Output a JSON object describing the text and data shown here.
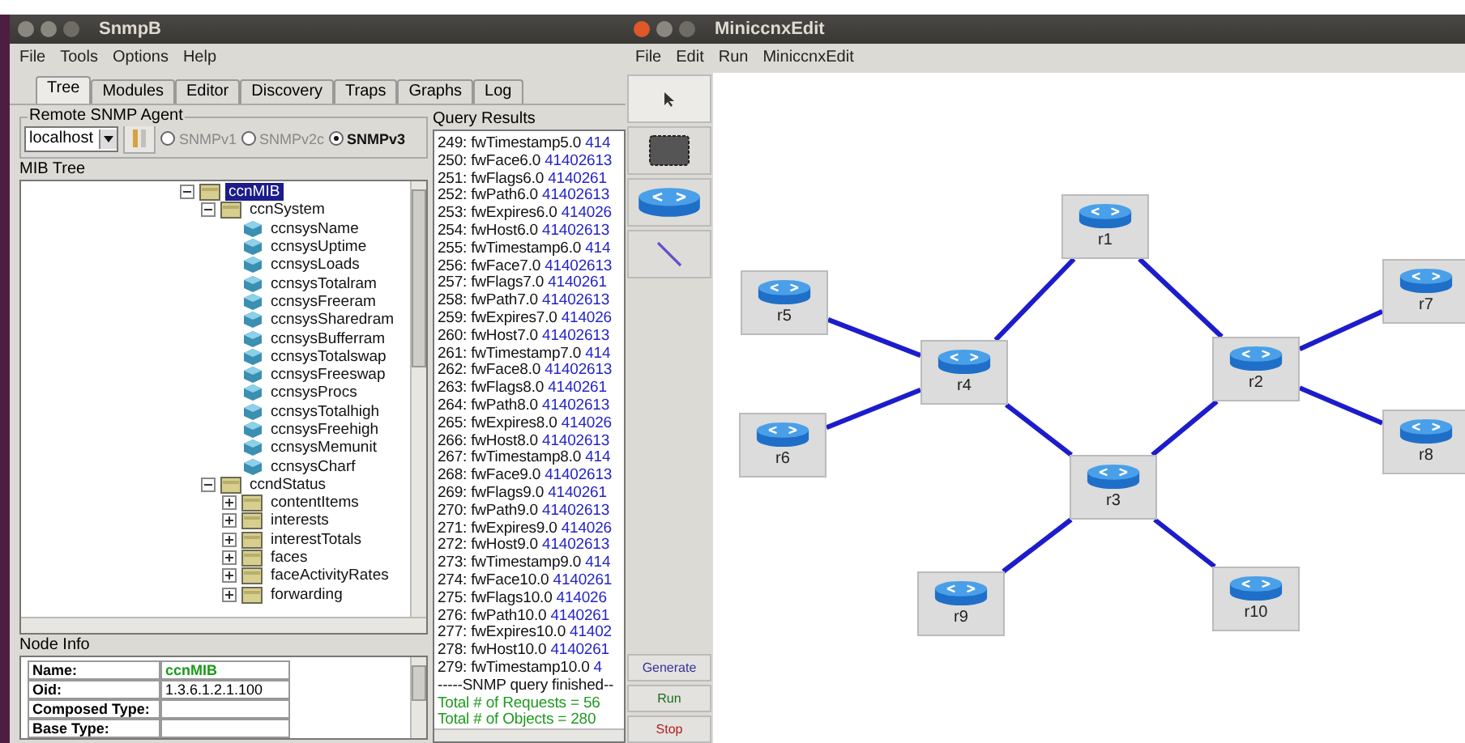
{
  "snmpb": {
    "title": "SnmpB",
    "menu": [
      "File",
      "Tools",
      "Options",
      "Help"
    ],
    "tabs": [
      {
        "label": "Tree",
        "selected": true
      },
      {
        "label": "Modules",
        "selected": false
      },
      {
        "label": "Editor",
        "selected": false
      },
      {
        "label": "Discovery",
        "selected": false
      },
      {
        "label": "Traps",
        "selected": false
      },
      {
        "label": "Graphs",
        "selected": false
      },
      {
        "label": "Log",
        "selected": false
      }
    ],
    "agent": {
      "title": "Remote SNMP Agent",
      "host": "localhost",
      "versions": [
        {
          "label": "SNMPv1",
          "selected": false,
          "disabled": true
        },
        {
          "label": "SNMPv2c",
          "selected": false,
          "disabled": true
        },
        {
          "label": "SNMPv3",
          "selected": true,
          "disabled": false
        }
      ]
    },
    "mib_tree": {
      "title": "MIB Tree",
      "items": [
        {
          "label": "ccnMIB",
          "kind": "folder",
          "expanded": true,
          "selected": true,
          "children": [
            {
              "label": "ccnSystem",
              "kind": "folder",
              "expanded": true,
              "selected": false,
              "children": [
                {
                  "label": "ccnsysName",
                  "kind": "leaf",
                  "selected": false
                },
                {
                  "label": "ccnsysUptime",
                  "kind": "leaf",
                  "selected": false
                },
                {
                  "label": "ccnsysLoads",
                  "kind": "leaf",
                  "selected": false
                },
                {
                  "label": "ccnsysTotalram",
                  "kind": "leaf",
                  "selected": false
                },
                {
                  "label": "ccnsysFreeram",
                  "kind": "leaf",
                  "selected": false
                },
                {
                  "label": "ccnsysSharedram",
                  "kind": "leaf",
                  "selected": false
                },
                {
                  "label": "ccnsysBufferram",
                  "kind": "leaf",
                  "selected": false
                },
                {
                  "label": "ccnsysTotalswap",
                  "kind": "leaf",
                  "selected": false
                },
                {
                  "label": "ccnsysFreeswap",
                  "kind": "leaf",
                  "selected": false
                },
                {
                  "label": "ccnsysProcs",
                  "kind": "leaf",
                  "selected": false
                },
                {
                  "label": "ccnsysTotalhigh",
                  "kind": "leaf",
                  "selected": false
                },
                {
                  "label": "ccnsysFreehigh",
                  "kind": "leaf",
                  "selected": false
                },
                {
                  "label": "ccnsysMemunit",
                  "kind": "leaf",
                  "selected": false
                },
                {
                  "label": "ccnsysCharf",
                  "kind": "leaf",
                  "selected": false
                }
              ]
            },
            {
              "label": "ccndStatus",
              "kind": "folder",
              "expanded": true,
              "selected": false,
              "children": [
                {
                  "label": "contentItems",
                  "kind": "folder",
                  "expanded": false,
                  "selected": false
                },
                {
                  "label": "interests",
                  "kind": "folder",
                  "expanded": false,
                  "selected": false
                },
                {
                  "label": "interestTotals",
                  "kind": "folder",
                  "expanded": false,
                  "selected": false
                },
                {
                  "label": "faces",
                  "kind": "folder",
                  "expanded": false,
                  "selected": false
                },
                {
                  "label": "faceActivityRates",
                  "kind": "folder",
                  "expanded": false,
                  "selected": false
                },
                {
                  "label": "forwarding",
                  "kind": "folder",
                  "expanded": false,
                  "selected": false
                }
              ]
            }
          ]
        }
      ]
    },
    "node_info": {
      "title": "Node Info",
      "rows": [
        {
          "label": "Name:",
          "value": "ccnMIB"
        },
        {
          "label": "Oid:",
          "value": "1.3.6.1.2.1.100"
        },
        {
          "label": "Composed Type:"
        },
        {
          "label": "Base Type:"
        }
      ]
    },
    "query_results": {
      "title": "Query Results",
      "lines": [
        {
          "kind": "result",
          "key": "249: fwTimestamp5.0",
          "value": "414"
        },
        {
          "kind": "result",
          "key": "250: fwFace6.0",
          "value": "41402613"
        },
        {
          "kind": "result",
          "key": "251: fwFlags6.0",
          "value": "4140261"
        },
        {
          "kind": "result",
          "key": "252: fwPath6.0",
          "value": "41402613"
        },
        {
          "kind": "result",
          "key": "253: fwExpires6.0",
          "value": "414026"
        },
        {
          "kind": "result",
          "key": "254: fwHost6.0",
          "value": "41402613"
        },
        {
          "kind": "result",
          "key": "255: fwTimestamp6.0",
          "value": "414"
        },
        {
          "kind": "result",
          "key": "256: fwFace7.0",
          "value": "41402613"
        },
        {
          "kind": "result",
          "key": "257: fwFlags7.0",
          "value": "4140261"
        },
        {
          "kind": "result",
          "key": "258: fwPath7.0",
          "value": "41402613"
        },
        {
          "kind": "result",
          "key": "259: fwExpires7.0",
          "value": "414026"
        },
        {
          "kind": "result",
          "key": "260: fwHost7.0",
          "value": "41402613"
        },
        {
          "kind": "result",
          "key": "261: fwTimestamp7.0",
          "value": "414"
        },
        {
          "kind": "result",
          "key": "262: fwFace8.0",
          "value": "41402613"
        },
        {
          "kind": "result",
          "key": "263: fwFlags8.0",
          "value": "4140261"
        },
        {
          "kind": "result",
          "key": "264: fwPath8.0",
          "value": "41402613"
        },
        {
          "kind": "result",
          "key": "265: fwExpires8.0",
          "value": "414026"
        },
        {
          "kind": "result",
          "key": "266: fwHost8.0",
          "value": "41402613"
        },
        {
          "kind": "result",
          "key": "267: fwTimestamp8.0",
          "value": "414"
        },
        {
          "kind": "result",
          "key": "268: fwFace9.0",
          "value": "41402613"
        },
        {
          "kind": "result",
          "key": "269: fwFlags9.0",
          "value": "4140261"
        },
        {
          "kind": "result",
          "key": "270: fwPath9.0",
          "value": "41402613"
        },
        {
          "kind": "result",
          "key": "271: fwExpires9.0",
          "value": "414026"
        },
        {
          "kind": "result",
          "key": "272: fwHost9.0",
          "value": "41402613"
        },
        {
          "kind": "result",
          "key": "273: fwTimestamp9.0",
          "value": "414"
        },
        {
          "kind": "result",
          "key": "274: fwFace10.0",
          "value": "4140261"
        },
        {
          "kind": "result",
          "key": "275: fwFlags10.0",
          "value": "414026"
        },
        {
          "kind": "result",
          "key": "276: fwPath10.0",
          "value": "4140261"
        },
        {
          "kind": "result",
          "key": "277: fwExpires10.0",
          "value": "41402"
        },
        {
          "kind": "result",
          "key": "278: fwHost10.0",
          "value": "4140261"
        },
        {
          "kind": "result",
          "key": "279: fwTimestamp10.0",
          "value": "4"
        },
        {
          "kind": "separator",
          "key": "-----SNMP query finished--"
        },
        {
          "kind": "total",
          "key": "Total # of Requests = 56"
        },
        {
          "kind": "total",
          "key": "Total # of Objects = 280"
        }
      ]
    }
  },
  "editor": {
    "title": "MiniccnxEdit",
    "menu": [
      "File",
      "Edit",
      "Run",
      "MiniccnxEdit"
    ],
    "tools": [
      {
        "kind": "select",
        "selected": true
      },
      {
        "kind": "host",
        "selected": false
      },
      {
        "kind": "router",
        "selected": false
      },
      {
        "kind": "link",
        "selected": false
      }
    ],
    "actions": [
      {
        "label": "Generate",
        "kind": "generate"
      },
      {
        "label": "Run",
        "kind": "run"
      },
      {
        "label": "Stop",
        "kind": "stop"
      }
    ],
    "nodes": [
      {
        "label": "r1"
      },
      {
        "label": "r2"
      },
      {
        "label": "r3"
      },
      {
        "label": "r4"
      },
      {
        "label": "r5"
      },
      {
        "label": "r6"
      },
      {
        "label": "r7"
      },
      {
        "label": "r8"
      },
      {
        "label": "r9"
      },
      {
        "label": "r10"
      }
    ]
  }
}
